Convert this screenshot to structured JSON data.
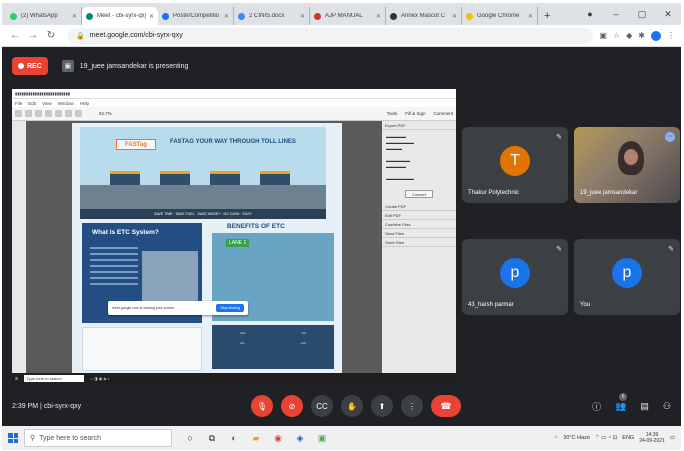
{
  "browser": {
    "tabs": [
      {
        "label": "(2) WhatsApp",
        "color": "#25d366",
        "active": false
      },
      {
        "label": "Meet - cbi-syrx-qxy",
        "color": "#00897b",
        "active": true
      },
      {
        "label": "PosterCompetitio",
        "color": "#1a73e8",
        "active": false
      },
      {
        "label": "2 CINIS.docx",
        "color": "#4285f4",
        "active": false
      },
      {
        "label": "AJP MANUAL",
        "color": "#d93025",
        "active": false
      },
      {
        "label": "Annex Mascot C",
        "color": "#333333",
        "active": false
      },
      {
        "label": "Google Chrome",
        "color": "#fbbc04",
        "active": false
      }
    ],
    "new_tab": "+",
    "url": "meet.google.com/cbi-syrx-qxy"
  },
  "meeting": {
    "rec_label": "REC",
    "presenting_text": "19_juee jamsandekar is presenting",
    "time": "2:39 PM",
    "code": "cbi-syrx-qxy",
    "people_count": "6"
  },
  "presentation": {
    "pdf_menu": [
      "File",
      "Edit",
      "View",
      "Window",
      "Help"
    ],
    "pdf_tools": [
      "Tools",
      "Fill & Sign",
      "Comment"
    ],
    "zoom": "62.7%",
    "banner_title": "FASTAG YOUR WAY THROUGH TOLL LINES",
    "fastag_logo": "FASTag",
    "banner_strip": "SAVE TIME · SAVE FUEL · SAVE MONEY · NO CASH · EASY",
    "etc_heading": "What is ETC System?",
    "benefits_heading": "BENEFITS OF ETC",
    "lane_label": "LANE 1",
    "snackbar_text": "meet.google.com is sharing your screen.",
    "snackbar_button": "Stop sharing",
    "right_panel": [
      "Export PDF",
      "Create PDF",
      "Edit PDF",
      "Combine Files",
      "Send Files",
      "Store Files"
    ],
    "right_panel_button": "Convert",
    "status_search": "Type here to search"
  },
  "participants": [
    {
      "name": "Thakur Polytechnic",
      "initial": "T",
      "color": "#e37400",
      "camera": false
    },
    {
      "name": "19_juee jamsandekar",
      "initial": "",
      "color": "",
      "camera": true
    },
    {
      "name": "43_harsh parmar",
      "initial": "p",
      "color": "#1a73e8",
      "camera": false
    },
    {
      "name": "You",
      "initial": "p",
      "color": "#1a73e8",
      "camera": false
    }
  ],
  "taskbar": {
    "search_placeholder": "Type here to search",
    "weather": "30°C Haze",
    "lang": "ENG",
    "time": "14:39",
    "date": "24-09-2021"
  }
}
